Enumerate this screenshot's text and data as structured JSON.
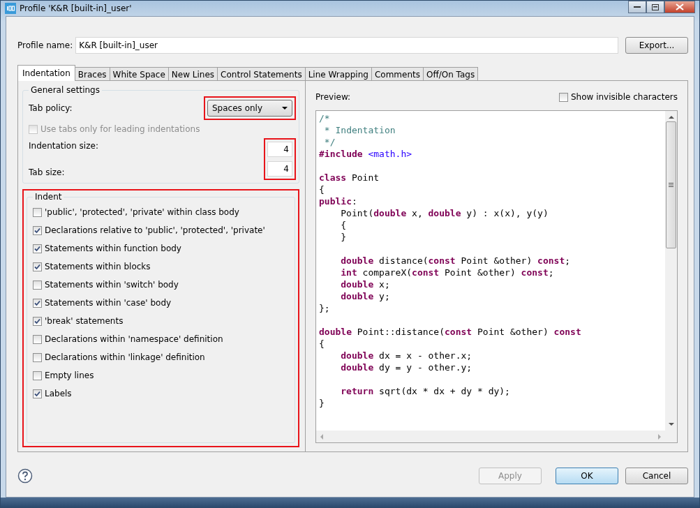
{
  "window": {
    "title": "Profile 'K&R [built-in]_user'"
  },
  "profile": {
    "label": "Profile name:",
    "value": "K&R [built-in]_user",
    "export_button": "Export..."
  },
  "tabs": [
    {
      "label": "Indentation",
      "selected": true
    },
    {
      "label": "Braces",
      "selected": false
    },
    {
      "label": "White Space",
      "selected": false
    },
    {
      "label": "New Lines",
      "selected": false
    },
    {
      "label": "Control Statements",
      "selected": false
    },
    {
      "label": "Line Wrapping",
      "selected": false
    },
    {
      "label": "Comments",
      "selected": false
    },
    {
      "label": "Off/On Tags",
      "selected": false
    }
  ],
  "general": {
    "title": "General settings",
    "tab_policy_label": "Tab policy:",
    "tab_policy_value": "Spaces only",
    "tab_policy_highlighted": true,
    "leading_tabs": {
      "label": "Use tabs only for leading indentations",
      "checked": false,
      "disabled": true
    },
    "sizes_highlighted": true,
    "indentation_size_label": "Indentation size:",
    "indentation_size": "4",
    "tab_size_label": "Tab size:",
    "tab_size": "4"
  },
  "indent": {
    "title": "Indent",
    "highlighted": true,
    "options": [
      {
        "label": "'public', 'protected', 'private' within class body",
        "checked": false
      },
      {
        "label": "Declarations relative to 'public', 'protected', 'private'",
        "checked": true
      },
      {
        "label": "Statements within function body",
        "checked": true
      },
      {
        "label": "Statements within blocks",
        "checked": true
      },
      {
        "label": "Statements within 'switch' body",
        "checked": false
      },
      {
        "label": "Statements within 'case' body",
        "checked": true
      },
      {
        "label": "'break' statements",
        "checked": true
      },
      {
        "label": "Declarations within 'namespace' definition",
        "checked": false
      },
      {
        "label": "Declarations within 'linkage' definition",
        "checked": false
      },
      {
        "label": "Empty lines",
        "checked": false
      },
      {
        "label": "Labels",
        "checked": true
      }
    ]
  },
  "preview": {
    "label": "Preview:",
    "show_invisible": {
      "label": "Show invisible characters",
      "checked": false
    },
    "lines": [
      {
        "kind": "code",
        "indented": false,
        "tokens": [
          {
            "kind": "comment",
            "text": "/*"
          }
        ]
      },
      {
        "kind": "code",
        "indented": false,
        "tokens": [
          {
            "kind": "comment",
            "text": " * Indentation"
          }
        ]
      },
      {
        "kind": "code",
        "indented": false,
        "tokens": [
          {
            "kind": "comment",
            "text": " */"
          }
        ]
      },
      {
        "kind": "code",
        "indented": false,
        "tokens": [
          {
            "kind": "keyword",
            "text": "#include"
          },
          {
            "kind": "string",
            "text": " <math.h>"
          }
        ]
      },
      {
        "kind": "blank"
      },
      {
        "kind": "code",
        "indented": false,
        "tokens": [
          {
            "kind": "keyword",
            "text": "class"
          },
          {
            "kind": "plain",
            "text": " Point"
          }
        ]
      },
      {
        "kind": "code",
        "indented": false,
        "tokens": [
          {
            "kind": "plain",
            "text": "{"
          }
        ]
      },
      {
        "kind": "code",
        "indented": false,
        "tokens": [
          {
            "kind": "keyword",
            "text": "public"
          },
          {
            "kind": "plain",
            "text": ":"
          }
        ]
      },
      {
        "kind": "code",
        "indented": true,
        "tokens": [
          {
            "kind": "plain",
            "text": "Point("
          },
          {
            "kind": "keyword",
            "text": "double"
          },
          {
            "kind": "plain",
            "text": " x, "
          },
          {
            "kind": "keyword",
            "text": "double"
          },
          {
            "kind": "plain",
            "text": " y) : x(x), y(y)"
          }
        ]
      },
      {
        "kind": "code",
        "indented": true,
        "tokens": [
          {
            "kind": "plain",
            "text": "{"
          }
        ]
      },
      {
        "kind": "code",
        "indented": true,
        "tokens": [
          {
            "kind": "plain",
            "text": "}"
          }
        ]
      },
      {
        "kind": "blank"
      },
      {
        "kind": "code",
        "indented": true,
        "tokens": [
          {
            "kind": "keyword",
            "text": "double"
          },
          {
            "kind": "plain",
            "text": " distance("
          },
          {
            "kind": "keyword",
            "text": "const"
          },
          {
            "kind": "plain",
            "text": " Point &other) "
          },
          {
            "kind": "keyword",
            "text": "const"
          },
          {
            "kind": "plain",
            "text": ";"
          }
        ]
      },
      {
        "kind": "code",
        "indented": true,
        "tokens": [
          {
            "kind": "keyword",
            "text": "int"
          },
          {
            "kind": "plain",
            "text": " compareX("
          },
          {
            "kind": "keyword",
            "text": "const"
          },
          {
            "kind": "plain",
            "text": " Point &other) "
          },
          {
            "kind": "keyword",
            "text": "const"
          },
          {
            "kind": "plain",
            "text": ";"
          }
        ]
      },
      {
        "kind": "code",
        "indented": true,
        "tokens": [
          {
            "kind": "keyword",
            "text": "double"
          },
          {
            "kind": "plain",
            "text": " x;"
          }
        ]
      },
      {
        "kind": "code",
        "indented": true,
        "tokens": [
          {
            "kind": "keyword",
            "text": "double"
          },
          {
            "kind": "plain",
            "text": " y;"
          }
        ]
      },
      {
        "kind": "code",
        "indented": false,
        "tokens": [
          {
            "kind": "plain",
            "text": "};"
          }
        ]
      },
      {
        "kind": "blank"
      },
      {
        "kind": "code",
        "indented": false,
        "tokens": [
          {
            "kind": "keyword",
            "text": "double"
          },
          {
            "kind": "plain",
            "text": " Point::distance("
          },
          {
            "kind": "keyword",
            "text": "const"
          },
          {
            "kind": "plain",
            "text": " Point &other) "
          },
          {
            "kind": "keyword",
            "text": "const"
          }
        ]
      },
      {
        "kind": "code",
        "indented": false,
        "tokens": [
          {
            "kind": "plain",
            "text": "{"
          }
        ]
      },
      {
        "kind": "code",
        "indented": true,
        "tokens": [
          {
            "kind": "keyword",
            "text": "double"
          },
          {
            "kind": "plain",
            "text": " dx = x - other.x;"
          }
        ]
      },
      {
        "kind": "code",
        "indented": true,
        "tokens": [
          {
            "kind": "keyword",
            "text": "double"
          },
          {
            "kind": "plain",
            "text": " dy = y - other.y;"
          }
        ]
      },
      {
        "kind": "blank"
      },
      {
        "kind": "code",
        "indented": true,
        "tokens": [
          {
            "kind": "keyword",
            "text": "return"
          },
          {
            "kind": "plain",
            "text": " sqrt(dx * dx + dy * dy);"
          }
        ]
      },
      {
        "kind": "code",
        "indented": false,
        "tokens": [
          {
            "kind": "plain",
            "text": "}"
          }
        ]
      }
    ]
  },
  "buttons": {
    "apply": {
      "label": "Apply",
      "disabled": true
    },
    "ok": {
      "label": "OK"
    },
    "cancel": {
      "label": "Cancel"
    }
  }
}
